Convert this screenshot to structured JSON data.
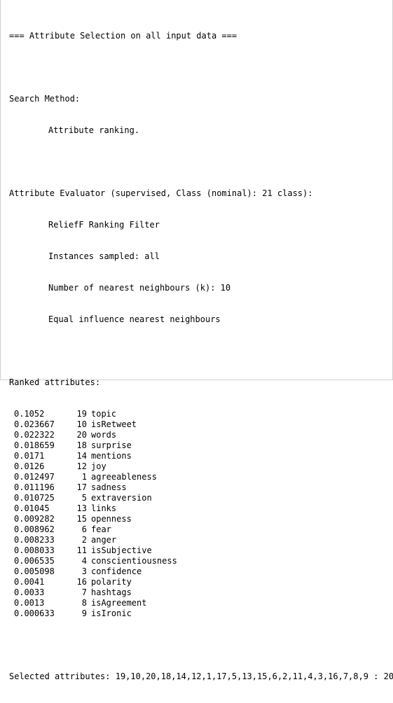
{
  "header": "=== Attribute Selection on all input data ===",
  "search": {
    "label": "Search Method:",
    "method": "Attribute ranking."
  },
  "evaluator": {
    "label": "Attribute Evaluator (supervised, Class (nominal): 21 class):",
    "lines": [
      "ReliefF Ranking Filter",
      "Instances sampled: all",
      "Number of nearest neighbours (k): 10",
      "Equal influence nearest neighbours"
    ]
  },
  "ranked": {
    "label": "Ranked attributes:",
    "rows": [
      {
        "score": "0.1052",
        "index": "19",
        "name": "topic"
      },
      {
        "score": "0.023667",
        "index": "10",
        "name": "isRetweet"
      },
      {
        "score": "0.022322",
        "index": "20",
        "name": "words"
      },
      {
        "score": "0.018659",
        "index": "18",
        "name": "surprise"
      },
      {
        "score": "0.0171",
        "index": "14",
        "name": "mentions"
      },
      {
        "score": "0.0126",
        "index": "12",
        "name": "joy"
      },
      {
        "score": "0.012497",
        "index": "1",
        "name": "agreeableness"
      },
      {
        "score": "0.011196",
        "index": "17",
        "name": "sadness"
      },
      {
        "score": "0.010725",
        "index": "5",
        "name": "extraversion"
      },
      {
        "score": "0.01045",
        "index": "13",
        "name": "links"
      },
      {
        "score": "0.009282",
        "index": "15",
        "name": "openness"
      },
      {
        "score": "0.008962",
        "index": "6",
        "name": "fear"
      },
      {
        "score": "0.008233",
        "index": "2",
        "name": "anger"
      },
      {
        "score": "0.008033",
        "index": "11",
        "name": "isSubjective"
      },
      {
        "score": "0.006535",
        "index": "4",
        "name": "conscientiousness"
      },
      {
        "score": "0.005098",
        "index": "3",
        "name": "confidence"
      },
      {
        "score": "0.0041",
        "index": "16",
        "name": "polarity"
      },
      {
        "score": "0.0033",
        "index": "7",
        "name": "hashtags"
      },
      {
        "score": "0.0013",
        "index": "8",
        "name": "isAgreement"
      },
      {
        "score": "0.000633",
        "index": "9",
        "name": "isIronic"
      }
    ]
  },
  "selected": "Selected attributes: 19,10,20,18,14,12,1,17,5,13,15,6,2,11,4,3,16,7,8,9 : 20"
}
